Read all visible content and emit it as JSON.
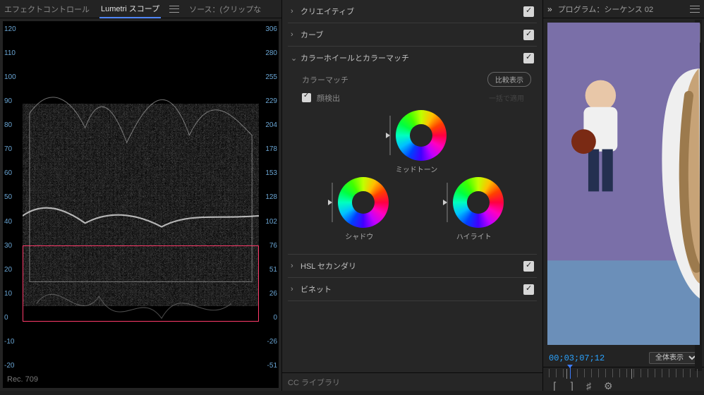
{
  "tabs_left": {
    "effect_controls": "エフェクトコントロール",
    "lumetri_scope": "Lumetri スコープ",
    "source": "ソース：(クリップな"
  },
  "scope": {
    "left_axis": [
      "120",
      "110",
      "100",
      "90",
      "80",
      "70",
      "60",
      "50",
      "40",
      "30",
      "20",
      "10",
      "0",
      "-10",
      "-20"
    ],
    "right_axis": [
      "306",
      "280",
      "255",
      "229",
      "204",
      "178",
      "153",
      "128",
      "102",
      "76",
      "51",
      "26",
      "0",
      "-26",
      "-51"
    ],
    "rec_label": "Rec. 709"
  },
  "lumetri": {
    "creative": "クリエイティブ",
    "curves": "カーブ",
    "wheels_section": "カラーホイールとカラーマッチ",
    "color_match": "カラーマッチ",
    "compare_btn": "比較表示",
    "face_detect": "顔検出",
    "apply_btn": "一括で適用",
    "midtone": "ミッドトーン",
    "shadow": "シャドウ",
    "highlight": "ハイライト",
    "hsl": "HSL セカンダリ",
    "vignette": "ビネット",
    "cc_lib": "CC ライブラリ"
  },
  "program": {
    "chevrons": "»",
    "title": "プログラム：シーケンス 02",
    "timecode": "00;03;07;12",
    "fit": "全体表示"
  },
  "chart_data": {
    "type": "other",
    "note": "Lumetri luma waveform scope",
    "left_scale": {
      "min": -20,
      "max": 120,
      "step": 10,
      "unit": "IRE"
    },
    "right_scale": {
      "min": -51,
      "max": 306,
      "step": 25.5,
      "unit": "8-bit"
    },
    "highlight_region_ire": [
      0,
      30
    ]
  }
}
